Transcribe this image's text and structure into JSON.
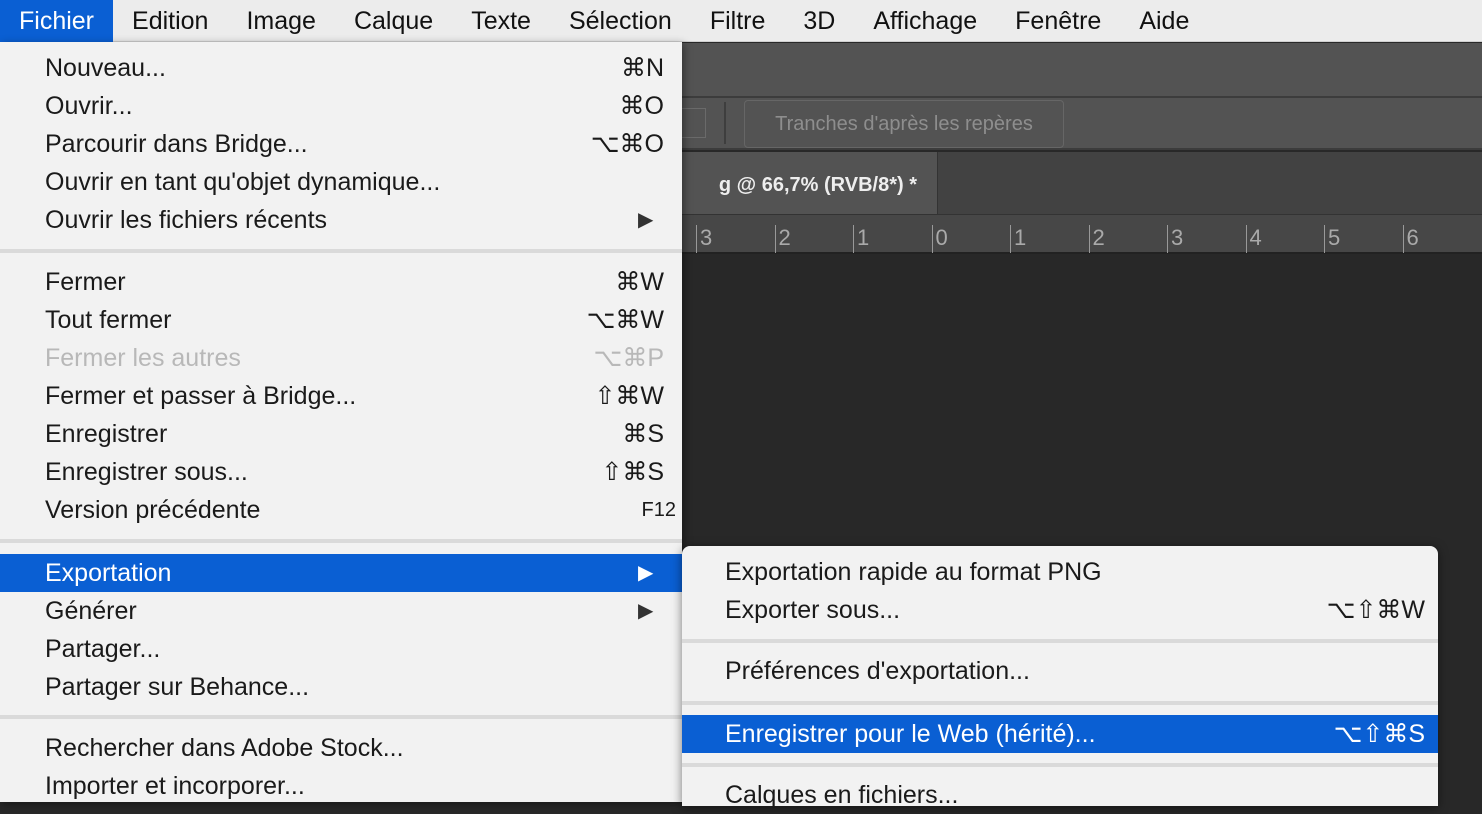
{
  "menubar": [
    "Fichier",
    "Edition",
    "Image",
    "Calque",
    "Texte",
    "Sélection",
    "Filtre",
    "3D",
    "Affichage",
    "Fenêtre",
    "Aide"
  ],
  "options": {
    "slices_button": "Tranches d'après les repères"
  },
  "document_tab": "g @ 66,7% (RVB/8*) *",
  "ruler": [
    "3",
    "2",
    "1",
    "0",
    "1",
    "2",
    "3",
    "4",
    "5",
    "6"
  ],
  "file_menu": [
    {
      "label": "Nouveau...",
      "shortcut": "⌘N"
    },
    {
      "label": "Ouvrir...",
      "shortcut": "⌘O"
    },
    {
      "label": "Parcourir dans Bridge...",
      "shortcut": "⌥⌘O"
    },
    {
      "label": "Ouvrir en tant qu'objet dynamique...",
      "shortcut": ""
    },
    {
      "label": "Ouvrir les fichiers récents",
      "shortcut": "",
      "submenu": true
    },
    {
      "label": "Fermer",
      "shortcut": "⌘W"
    },
    {
      "label": "Tout fermer",
      "shortcut": "⌥⌘W"
    },
    {
      "label": "Fermer les autres",
      "shortcut": "⌥⌘P",
      "disabled": true
    },
    {
      "label": "Fermer et passer à Bridge...",
      "shortcut": "⇧⌘W"
    },
    {
      "label": "Enregistrer",
      "shortcut": "⌘S"
    },
    {
      "label": "Enregistrer sous...",
      "shortcut": "⇧⌘S"
    },
    {
      "label": "Version précédente",
      "shortcut": "F12"
    },
    {
      "label": "Exportation",
      "shortcut": "",
      "submenu": true,
      "selected": true
    },
    {
      "label": "Générer",
      "shortcut": "",
      "submenu": true
    },
    {
      "label": "Partager...",
      "shortcut": ""
    },
    {
      "label": "Partager sur Behance...",
      "shortcut": ""
    },
    {
      "label": "Rechercher dans Adobe Stock...",
      "shortcut": ""
    },
    {
      "label": "Importer et incorporer...",
      "shortcut": ""
    }
  ],
  "export_submenu": [
    {
      "label": "Exportation rapide au format PNG",
      "shortcut": ""
    },
    {
      "label": "Exporter sous...",
      "shortcut": "⌥⇧⌘W"
    },
    {
      "label": "Préférences d'exportation...",
      "shortcut": ""
    },
    {
      "label": "Enregistrer pour le Web (hérité)...",
      "shortcut": "⌥⇧⌘S",
      "selected": true
    },
    {
      "label": "Calques en fichiers...",
      "shortcut": ""
    }
  ],
  "colors": {
    "highlight": "#0a5fd3",
    "menu_bg": "#f2f2f2",
    "canvas": "#282828"
  }
}
